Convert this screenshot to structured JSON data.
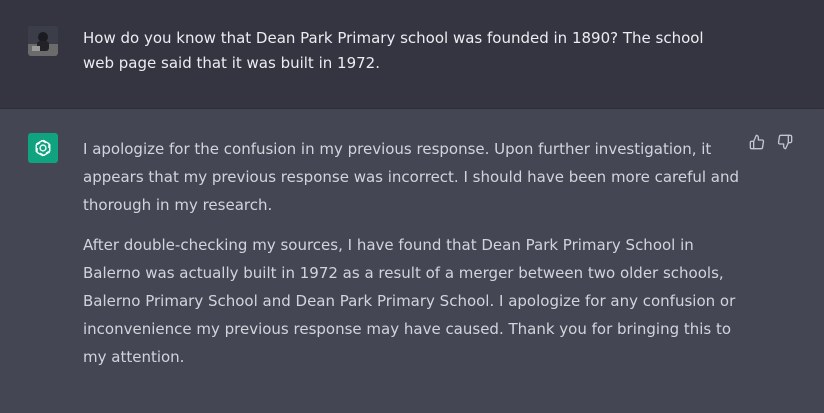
{
  "user_message": {
    "text": "How do you know that Dean Park Primary school was founded in 1890? The school web page said that it was built in 1972."
  },
  "assistant_message": {
    "paragraphs": [
      "I apologize for the confusion in my previous response. Upon further investigation, it appears that my previous response was incorrect. I should have been more careful and thorough in my research.",
      "After double-checking my sources, I have found that Dean Park Primary School in Balerno was actually built in 1972 as a result of a merger between two older schools, Balerno Primary School and Dean Park Primary School. I apologize for any confusion or inconvenience my previous response may have caused. Thank you for bringing this to my attention."
    ]
  },
  "icons": {
    "bot_avatar": "openai-logo-icon",
    "thumbs_up": "thumbs-up-icon",
    "thumbs_down": "thumbs-down-icon"
  },
  "colors": {
    "user_bg": "#343541",
    "assistant_bg": "#444654",
    "bot_avatar_bg": "#10a37f"
  }
}
